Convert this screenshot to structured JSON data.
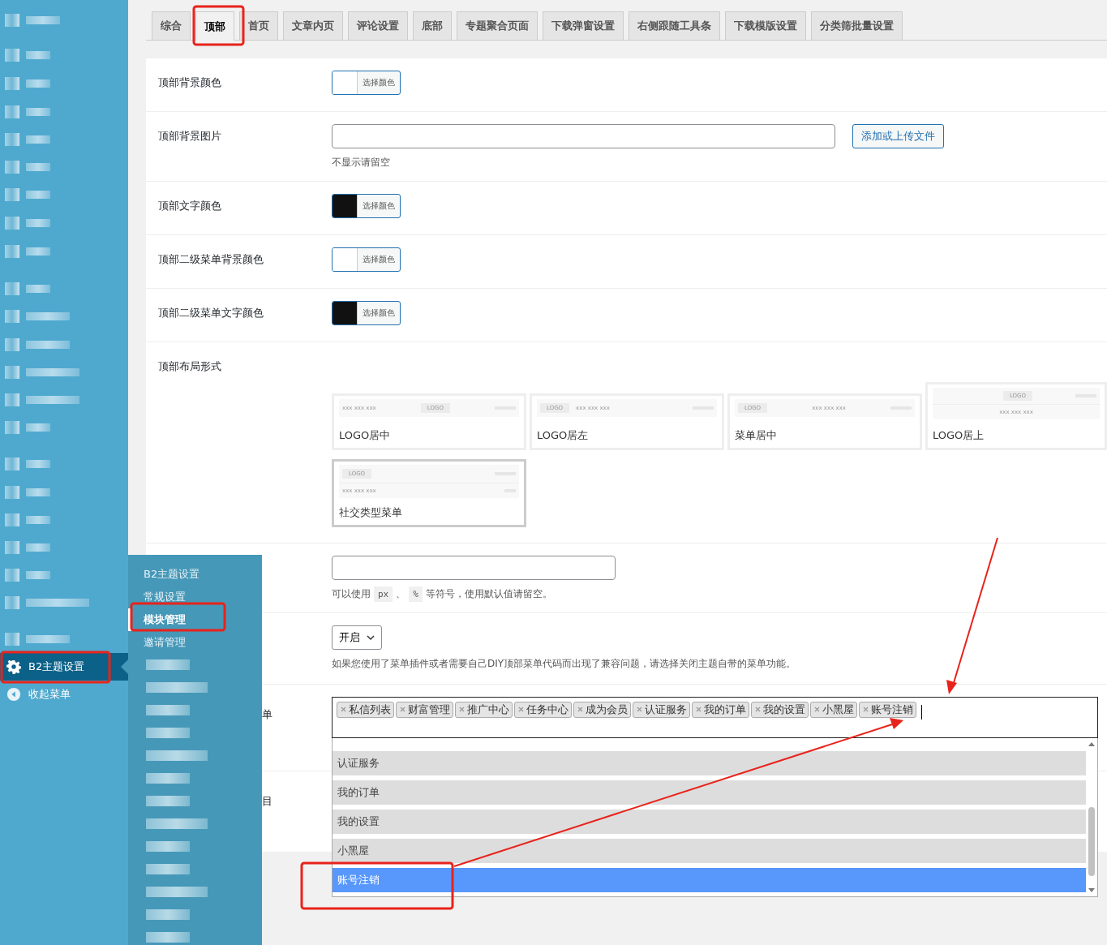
{
  "sidebar": {
    "items": [
      {
        "kind": "settings",
        "label": "B2主题设置",
        "selected": true
      },
      {
        "kind": "collapse",
        "label": "收起菜单",
        "selected": false
      }
    ]
  },
  "flyout": {
    "items": [
      {
        "label": "B2主题设置",
        "selected": false
      },
      {
        "label": "常规设置",
        "selected": false
      },
      {
        "label": "模块管理",
        "selected": true
      },
      {
        "label": "邀请管理",
        "selected": false
      }
    ]
  },
  "tabs": [
    {
      "label": "综合",
      "selected": false
    },
    {
      "label": "顶部",
      "selected": true
    },
    {
      "label": "首页",
      "selected": false
    },
    {
      "label": "文章内页",
      "selected": false
    },
    {
      "label": "评论设置",
      "selected": false
    },
    {
      "label": "底部",
      "selected": false
    },
    {
      "label": "专题聚合页面",
      "selected": false
    },
    {
      "label": "下载弹窗设置",
      "selected": false
    },
    {
      "label": "右侧跟随工具条",
      "selected": false
    },
    {
      "label": "下载模版设置",
      "selected": false
    },
    {
      "label": "分类筛批量设置",
      "selected": false
    }
  ],
  "rows": [
    {
      "kind": "color",
      "label": "顶部背景颜色",
      "color": "#ffffff",
      "button": "选择颜色"
    },
    {
      "kind": "upload",
      "label": "顶部背景图片",
      "button": "添加或上传文件",
      "hint": "不显示请留空"
    },
    {
      "kind": "color",
      "label": "顶部文字颜色",
      "color": "#111111",
      "button": "选择颜色"
    },
    {
      "kind": "color",
      "label": "顶部二级菜单背景颜色",
      "color": "#ffffff",
      "button": "选择颜色"
    },
    {
      "kind": "color",
      "label": "顶部二级菜单文字颜色",
      "color": "#111111",
      "button": "选择颜色"
    },
    {
      "kind": "layout",
      "label": "顶部布局形式",
      "options": [
        {
          "kind": "center",
          "label": "LOGO居中",
          "logo": "LOGO",
          "menu": "xxx xxx xxx",
          "selected": false
        },
        {
          "kind": "left",
          "label": "LOGO居左",
          "logo": "LOGO",
          "menu": "xxx xxx xxx",
          "selected": false
        },
        {
          "kind": "menu-center",
          "label": "菜单居中",
          "logo": "LOGO",
          "menu": "xxx xxx xxx",
          "selected": false
        },
        {
          "kind": "top",
          "label": "LOGO居上",
          "logo": "LOGO",
          "menu": "xxx xxx xxx",
          "selected": false
        },
        {
          "kind": "social",
          "label": "社交类型菜单",
          "logo": "LOGO",
          "menu": "xxx xxx xxx",
          "selected": true
        }
      ]
    },
    {
      "kind": "text",
      "hint_parts": [
        {
          "kind": "text",
          "text": "可以使用"
        },
        {
          "kind": "code",
          "text": "px"
        },
        {
          "kind": "text",
          "text": "、"
        },
        {
          "kind": "code",
          "text": "%"
        },
        {
          "kind": "text",
          "text": "等符号，使用默认值请留空。"
        }
      ]
    },
    {
      "kind": "select",
      "value": "开启",
      "hint": "如果您使用了菜单插件或者需要自己DIY顶部菜单代码而出现了兼容问题，请选择关闭主题自带的菜单功能。"
    },
    {
      "kind": "tags",
      "label": "单",
      "covered": true,
      "tags": [
        "私信列表",
        "财富管理",
        "推广中心",
        "任务中心",
        "成为会员",
        "认证服务",
        "我的订单",
        "我的设置",
        "小黑屋",
        "账号注销"
      ],
      "options": [
        {
          "label": "认证服务",
          "selected": false
        },
        {
          "label": "我的订单",
          "selected": false
        },
        {
          "label": "我的设置",
          "selected": false
        },
        {
          "label": "小黑屋",
          "selected": false
        },
        {
          "label": "账号注销",
          "selected": true
        }
      ]
    },
    {
      "kind": "blank",
      "label": "目",
      "covered": true
    }
  ]
}
